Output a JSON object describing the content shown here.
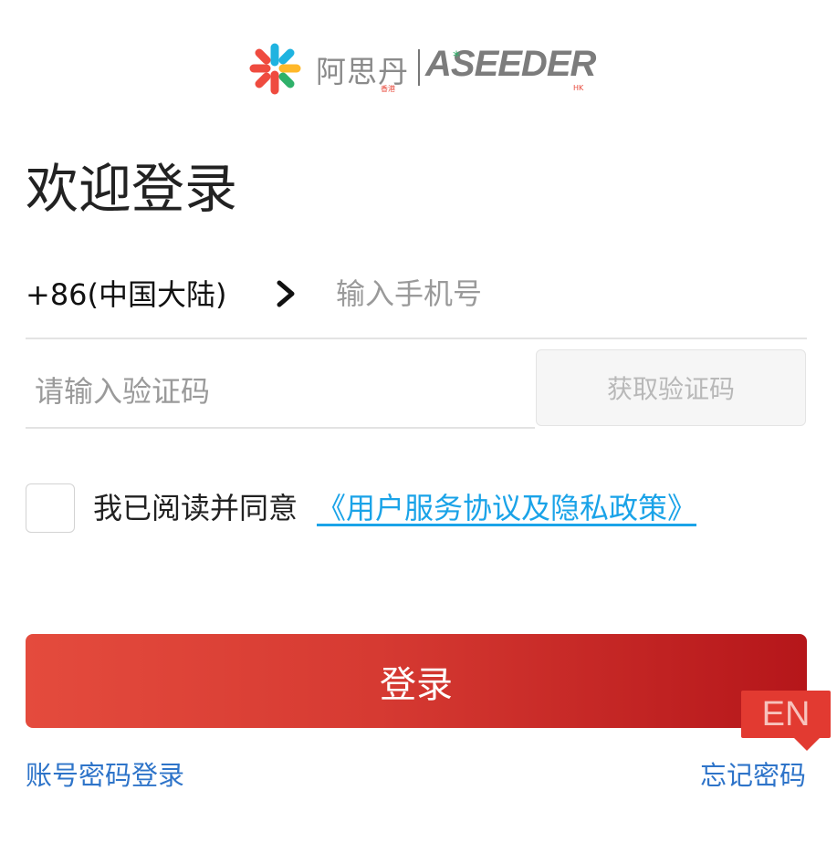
{
  "logo": {
    "cn_name": "阿思丹",
    "cn_sub": "香港",
    "en_name": "ASEEDER",
    "en_star": "*",
    "en_sub": "HK"
  },
  "title": "欢迎登录",
  "phone": {
    "country_code": "+86(中国大陆)",
    "placeholder": "输入手机号"
  },
  "verification": {
    "placeholder": "请输入验证码",
    "get_code_label": "获取验证码"
  },
  "agreement": {
    "checked": false,
    "text": "我已阅读并同意",
    "link_text": "《用户服务协议及隐私政策》"
  },
  "login_button": "登录",
  "language_badge": "EN",
  "links": {
    "password_login": "账号密码登录",
    "forgot_password": "忘记密码"
  },
  "colors": {
    "primary_gradient_start": "#e44b3d",
    "primary_gradient_end": "#b5161a",
    "link_blue": "#1aa3e8",
    "secondary_link": "#2e74c9"
  }
}
